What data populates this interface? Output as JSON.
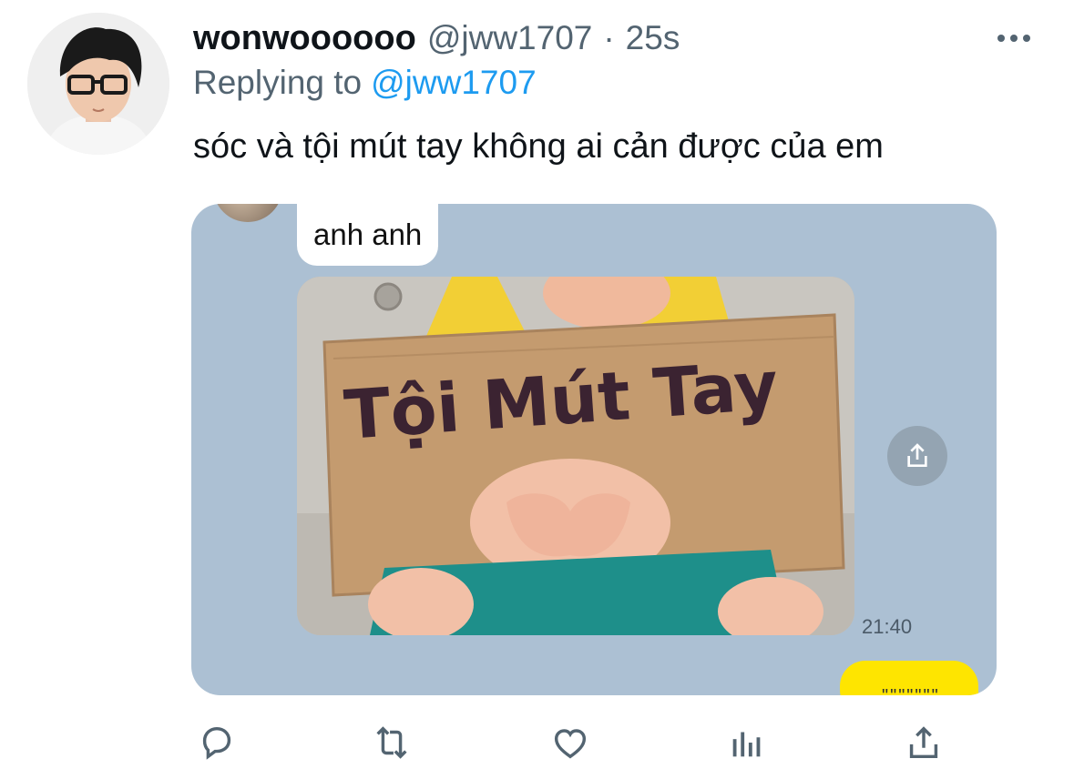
{
  "tweet": {
    "display_name": "wonwoooooo",
    "handle": "@jww1707",
    "separator": "·",
    "time": "25s",
    "replying_prefix": "Replying to",
    "replying_handle": "@jww1707",
    "text": "sóc và tội mút tay không ai cản được của em"
  },
  "media": {
    "chat_bubble": "anh anh",
    "sign_text": "Tội Mút Tay",
    "chat_time": "21:40",
    "yellow_bubble_text": "\"\"\"\"\"\"\""
  },
  "icons": [
    "avatar",
    "more-icon",
    "share-icon",
    "reply-icon",
    "retweet-icon",
    "like-icon",
    "analytics-icon",
    "share-icon"
  ],
  "colors": {
    "accent": "#1d9bf0",
    "muted": "#536471",
    "chat_bg": "#acc0d3",
    "kakao_yellow": "#fee500"
  }
}
